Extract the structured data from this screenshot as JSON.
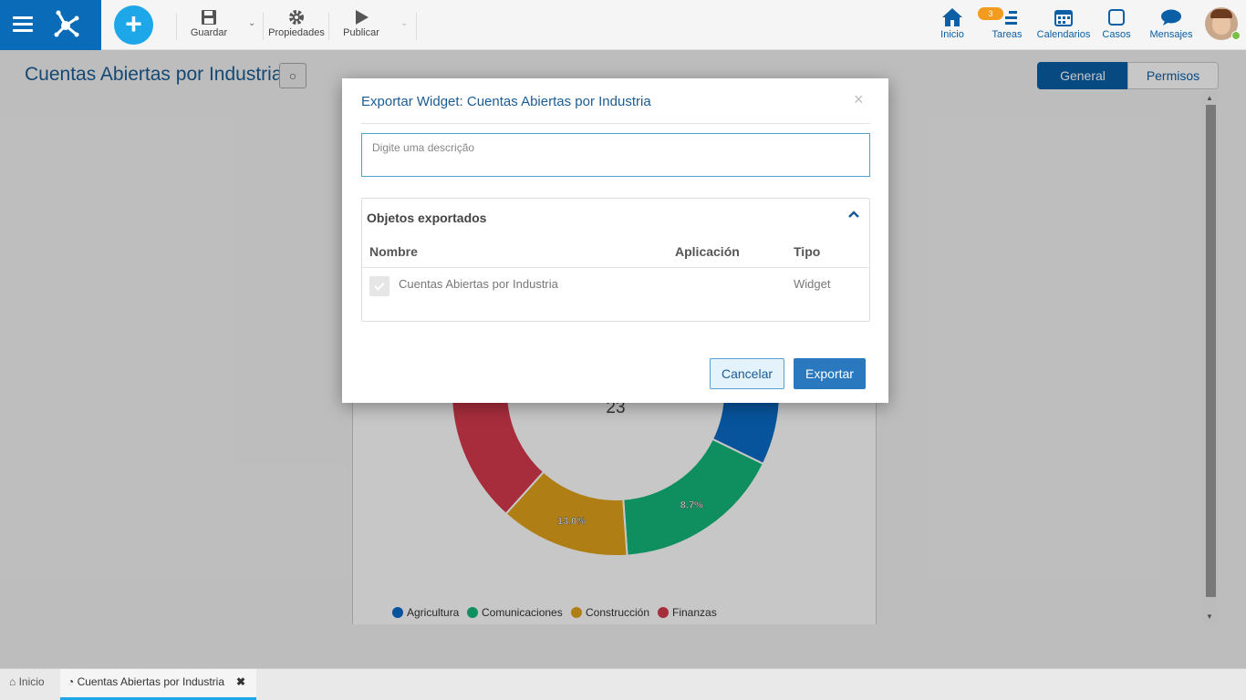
{
  "toolbar": {
    "save_label": "Guardar",
    "properties_label": "Propiedades",
    "publish_label": "Publicar"
  },
  "nav": {
    "home": "Inicio",
    "tasks": "Tareas",
    "tasks_badge": "3",
    "calendars": "Calendarios",
    "cases": "Casos",
    "messages": "Mensajes"
  },
  "page": {
    "title": "Cuentas Abiertas por Industria",
    "tab_general": "General",
    "tab_permisos": "Permisos"
  },
  "chart_data": {
    "type": "pie",
    "center_value": "23",
    "slices": [
      {
        "name": "Agricultura",
        "color": "#0a6cc8"
      },
      {
        "name": "Comunicaciones",
        "color": "#14b87a",
        "label": "8.7%"
      },
      {
        "name": "Construcción",
        "color": "#e0a21a",
        "label": "13.0%"
      },
      {
        "name": "Finanzas",
        "color": "#d63a4e"
      }
    ]
  },
  "modal": {
    "title": "Exportar Widget: Cuentas Abiertas por Industria",
    "close": "×",
    "description_placeholder": "Digite uma descrição",
    "section_title": "Objetos exportados",
    "col_name": "Nombre",
    "col_app": "Aplicación",
    "col_type": "Tipo",
    "rows": [
      {
        "name": "Cuentas Abiertas por Industria",
        "app": "",
        "type": "Widget"
      }
    ],
    "cancel": "Cancelar",
    "export": "Exportar"
  },
  "bottom_tabs": {
    "home": "Inicio",
    "active": "Cuentas Abiertas por Industria"
  }
}
